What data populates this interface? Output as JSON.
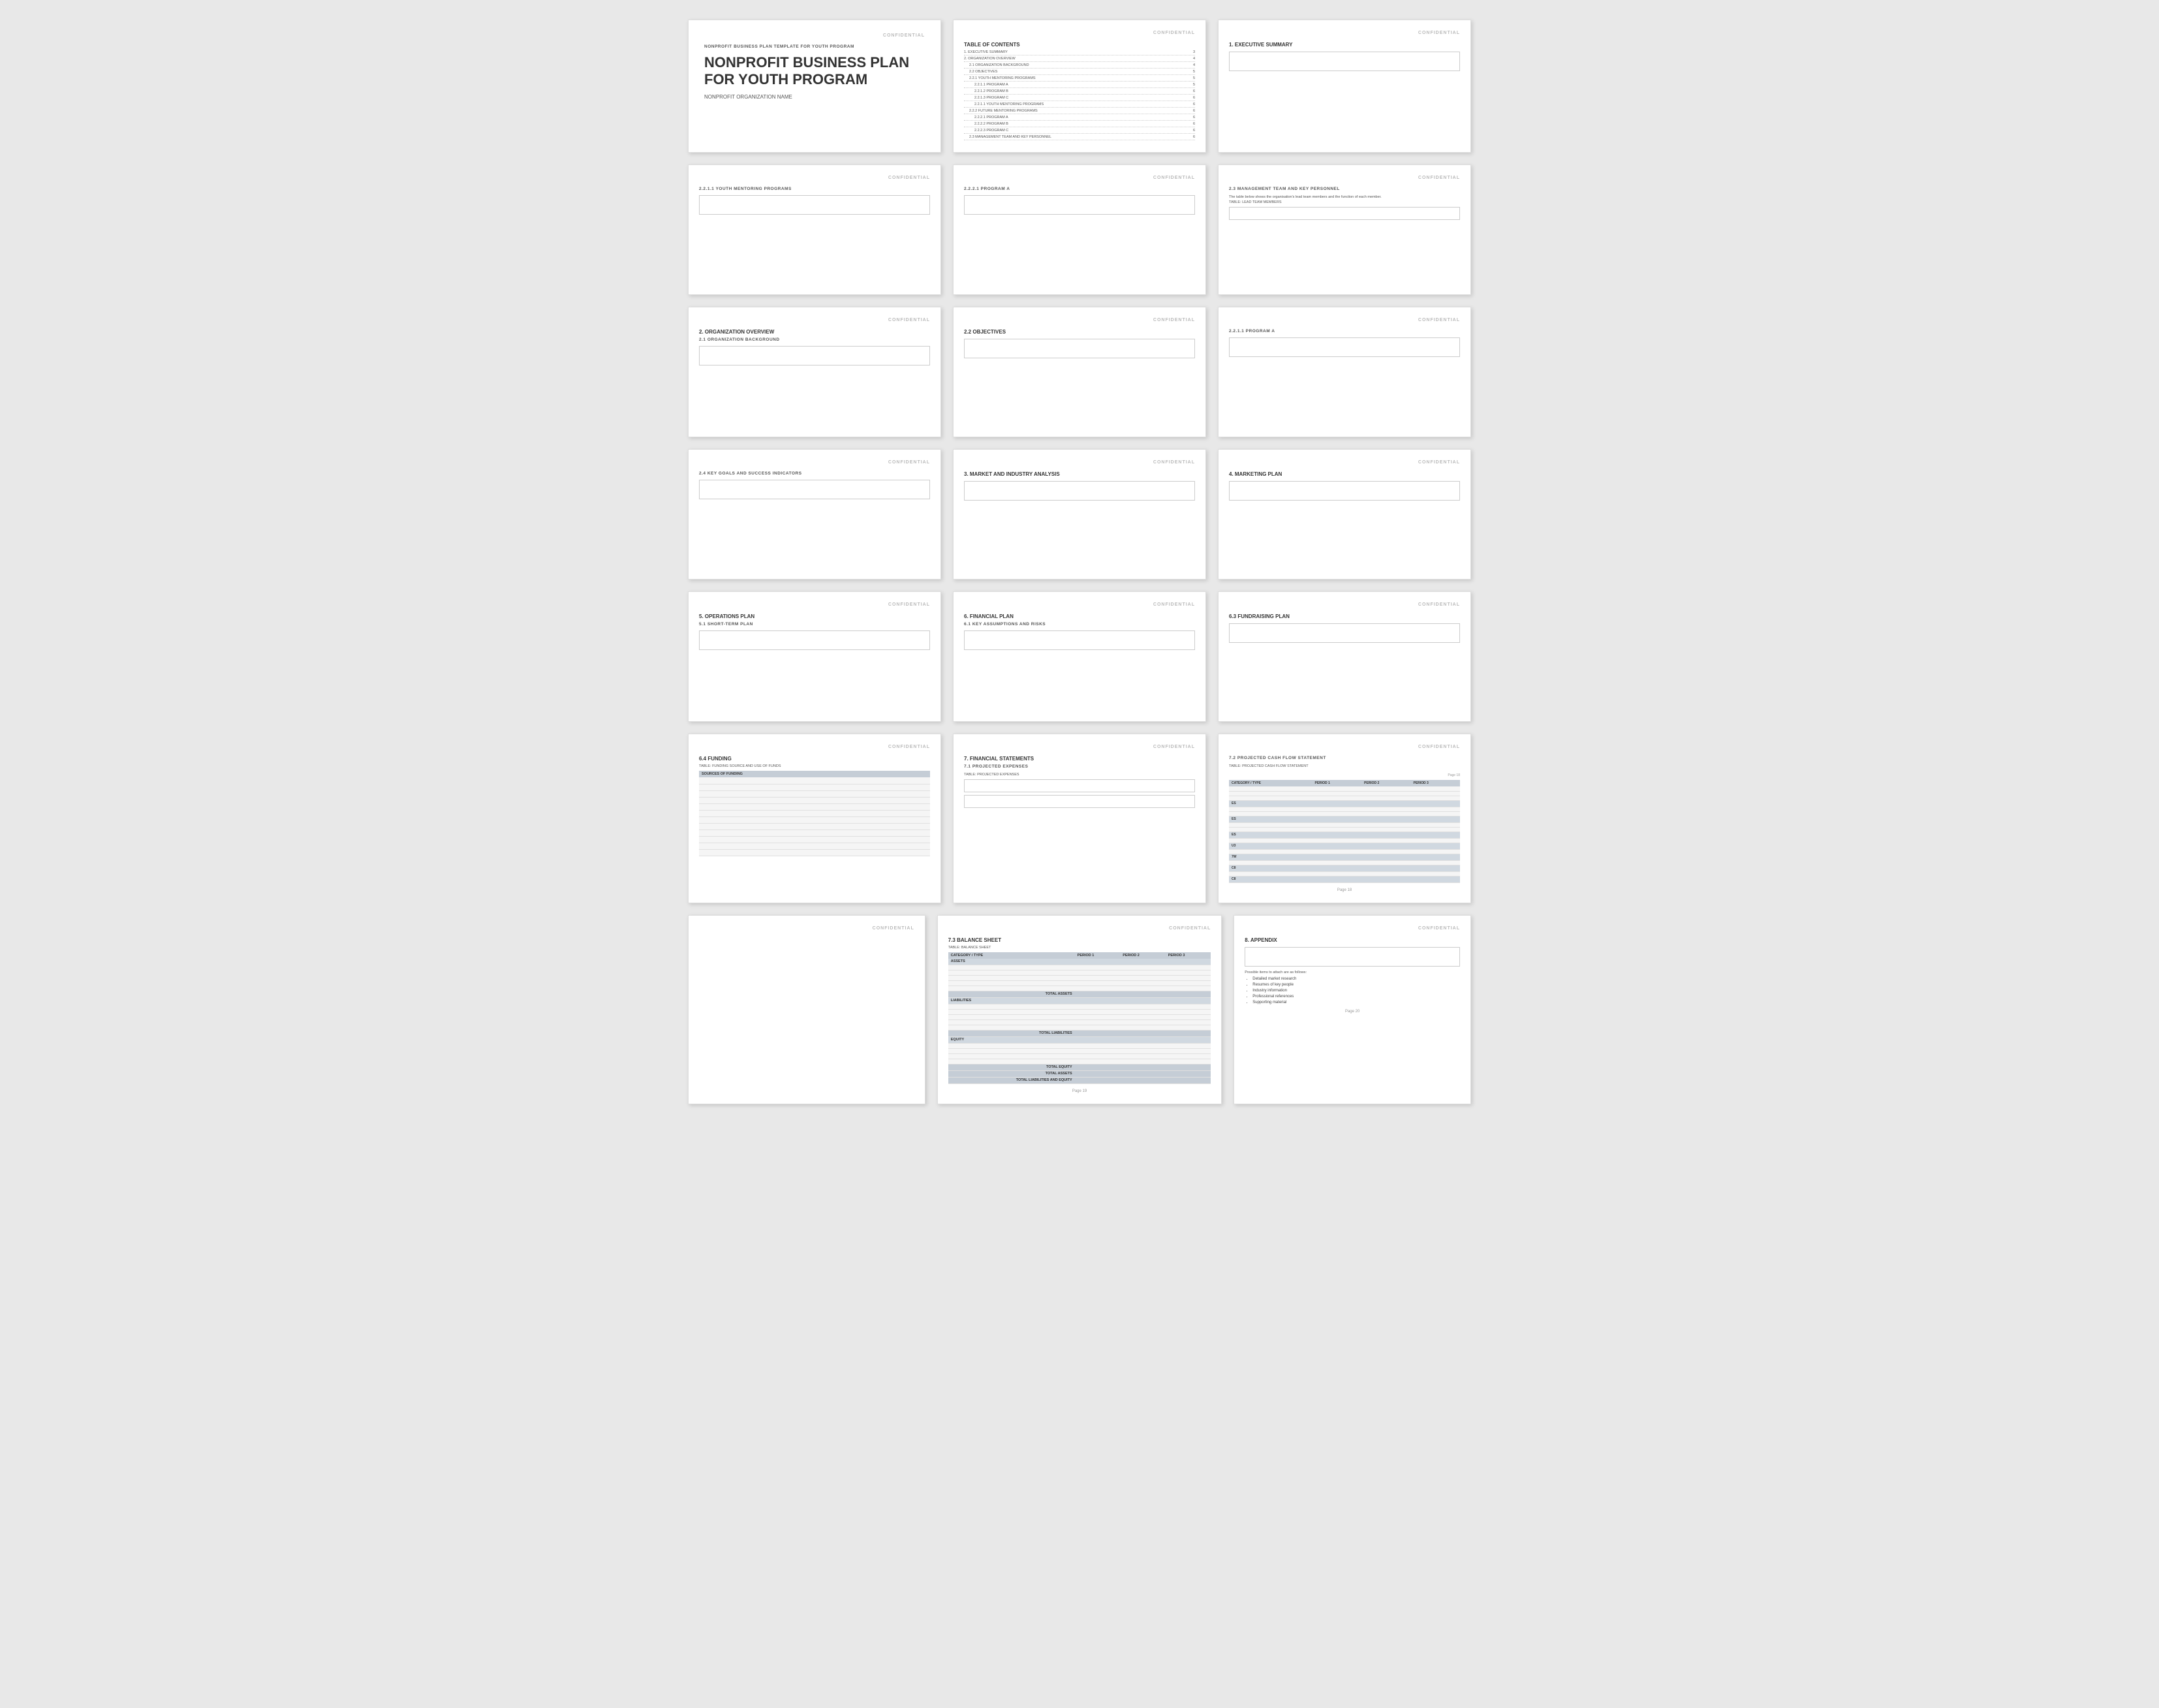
{
  "app": {
    "background_color": "#e8e8e8"
  },
  "confidential": "CONFIDENTIAL",
  "pages": {
    "cover": {
      "subtitle": "NONPROFIT BUSINESS PLAN TEMPLATE FOR YOUTH PROGRAM",
      "main_title": "NONPROFIT BUSINESS PLAN FOR YOUTH PROGRAM",
      "org_name": "NONPROFIT ORGANIZATION NAME"
    },
    "toc": {
      "title": "TABLE OF CONTENTS",
      "items": [
        {
          "label": "1. EXECUTIVE SUMMARY",
          "page": "3",
          "indent": 0
        },
        {
          "label": "2. ORGANIZATION OVERVIEW",
          "page": "4",
          "indent": 0
        },
        {
          "label": "2.1 ORGANIZATION BACKGROUND",
          "page": "4",
          "indent": 1
        },
        {
          "label": "2.2 OBJECTIVES",
          "page": "5",
          "indent": 1
        },
        {
          "label": "2.2.1 YOUTH MENTORING PROGRAMS",
          "page": "5",
          "indent": 1
        },
        {
          "label": "2.2.1.1 PROGRAM A",
          "page": "5",
          "indent": 2
        },
        {
          "label": "2.2.1.2 PROGRAM B",
          "page": "6",
          "indent": 2
        },
        {
          "label": "2.2.1.3 PROGRAM C",
          "page": "6",
          "indent": 2
        },
        {
          "label": "2.2.1.1 YOUTH MENTORING PROGRAMS",
          "page": "6",
          "indent": 2
        },
        {
          "label": "2.2.2 FUTURE MENTORING PROGRAMS",
          "page": "6",
          "indent": 1
        },
        {
          "label": "2.2.2.1 PROGRAM A",
          "page": "6",
          "indent": 2
        },
        {
          "label": "2.2.2.2 PROGRAM B",
          "page": "6",
          "indent": 2
        },
        {
          "label": "2.2.2.3 PROGRAM C",
          "page": "6",
          "indent": 2
        },
        {
          "label": "2.3 MANAGEMENT TEAM AND KEY PERSONNEL",
          "page": "6",
          "indent": 1
        }
      ]
    },
    "executive_summary": {
      "title": "1. EXECUTIVE SUMMARY"
    },
    "mentoring_programs": {
      "title": "2.2.1.1 YOUTH MENTORING PROGRAMS"
    },
    "program_a_1": {
      "title": "2.2.2.1 PROGRAM A"
    },
    "management_team": {
      "title": "2.3  MANAGEMENT TEAM AND KEY PERSONNEL",
      "desc": "The table below shows the organisation's lead team members and the function of each member.",
      "table_label": "TABLE:  LEAD TEAM MEMBERS"
    },
    "org_overview": {
      "title": "2. ORGANIZATION OVERVIEW",
      "sub": "2.1  ORGANIZATION BACKGROUND"
    },
    "objectives": {
      "title": "2.2  OBJECTIVES"
    },
    "program_a_2": {
      "title": "2.2.1.1  PROGRAM A"
    },
    "key_goals": {
      "title": "2.4  KEY GOALS AND SUCCESS INDICATORS"
    },
    "market_analysis": {
      "title": "3. MARKET AND INDUSTRY ANALYSIS"
    },
    "marketing_plan": {
      "title": "4. MARKETING PLAN"
    },
    "operations_plan": {
      "title": "5. OPERATIONS PLAN",
      "sub": "5.1  SHORT-TERM PLAN"
    },
    "financial_plan": {
      "title": "6. FINANCIAL PLAN",
      "sub": "6.1  KEY ASSUMPTIONS AND RISKS"
    },
    "fundraising_plan": {
      "title": "6.3  FUNDRAISING PLAN"
    },
    "funding": {
      "title": "6.4   FUNDING",
      "sources_label": "TABLE: FUNDING SOURCE AND USE OF FUNDS",
      "sources_header": "SOURCES OF FUNDING"
    },
    "financial_statements": {
      "title": "7. FINANCIAL STATEMENTS",
      "sub": "7.1  PROJECTED EXPENSES",
      "table_label": "TABLE:  PROJECTED EXPENSES"
    },
    "cash_flow": {
      "title": "7.2  PROJECTED CASH FLOW STATEMENT",
      "table_label": "TABLE:  PROJECTED CASH FLOW STATEMENT",
      "headers": [
        "CATEGORY / TYPE",
        "PERIOD 1",
        "PERIOD 2",
        "PERIOD 3"
      ]
    },
    "balance_sheet": {
      "title": "7.3  BALANCE SHEET",
      "table_label": "TABLE:  BALANCE SHEET",
      "headers": [
        "CATEGORY / TYPE",
        "PERIOD 1",
        "PERIOD 2",
        "PERIOD 3"
      ],
      "sections": {
        "assets": "ASSETS",
        "total_assets": "TOTAL ASSETS",
        "liabilities": "LIABILITIES",
        "total_liabilities": "TOTAL LIABILITIES",
        "equity": "EQUITY",
        "total_equity": "TOTAL EQUITY",
        "total_assets2": "TOTAL ASSETS",
        "total_liabilities_equity": "TOTAL LIABILITIES AND EQUITY"
      },
      "page": "Page 19"
    },
    "appendix": {
      "title": "8. APPENDIX",
      "intro": "Possible items to attach are as follows:",
      "items": [
        "Detailed market research",
        "Resumes of key people",
        "Industry information",
        "Professional references",
        "Supporting material"
      ],
      "page": "Page 20"
    },
    "cash_flow_page18": {
      "page": "Page 18",
      "sections": {
        "s1": "ES",
        "s2": "ES",
        "s3": "ES",
        "s4": "U3",
        "s5": "7W",
        "s6": "C8",
        "s7": "C8"
      }
    }
  }
}
